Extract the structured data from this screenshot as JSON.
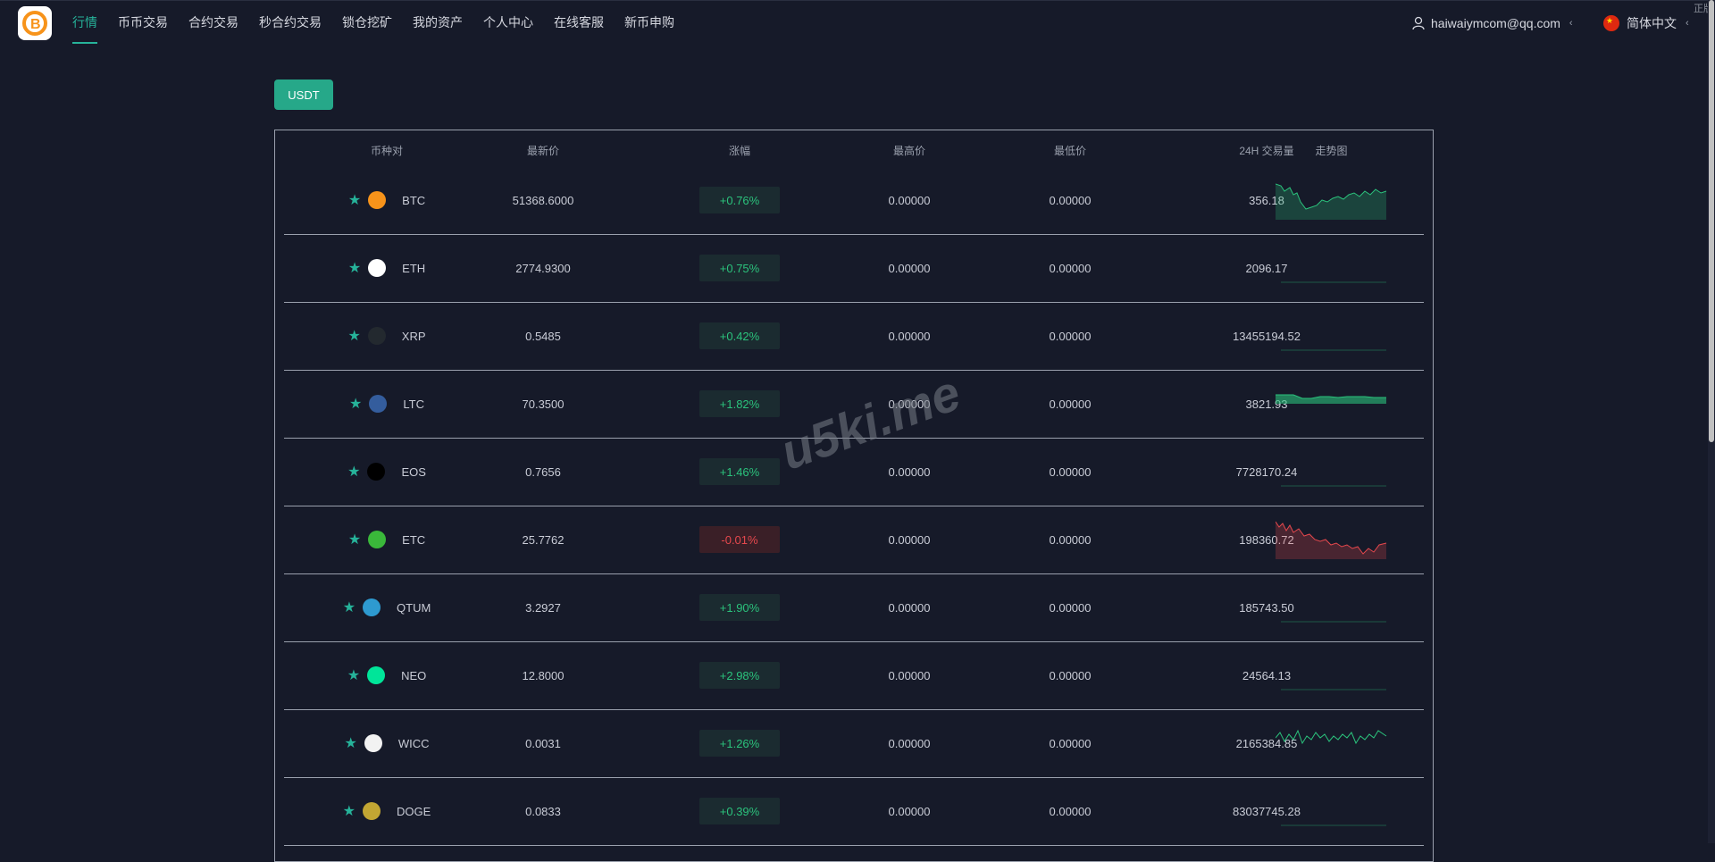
{
  "nav": {
    "items": [
      {
        "label": "行情",
        "active": true
      },
      {
        "label": "币币交易"
      },
      {
        "label": "合约交易"
      },
      {
        "label": "秒合约交易"
      },
      {
        "label": "锁仓挖矿"
      },
      {
        "label": "我的资产"
      },
      {
        "label": "个人中心"
      },
      {
        "label": "在线客服"
      },
      {
        "label": "新币申购"
      }
    ],
    "user_email": "haiwaiymcom@qq.com",
    "language": "简体中文",
    "corner_text": "正版"
  },
  "market_tab": "USDT",
  "table": {
    "headers": [
      "币种对",
      "最新价",
      "涨幅",
      "最高价",
      "最低价",
      "24H 交易量",
      "走势图"
    ],
    "rows": [
      {
        "symbol": "BTC",
        "price": "51368.6000",
        "change": "+0.76%",
        "high": "0.00000",
        "low": "0.00000",
        "volume": "356.18",
        "trend": "up",
        "coin_color": "#f7931a",
        "icon": "bitcoin-icon"
      },
      {
        "symbol": "ETH",
        "price": "2774.9300",
        "change": "+0.75%",
        "high": "0.00000",
        "low": "0.00000",
        "volume": "2096.17",
        "trend": "flat",
        "coin_color": "#ffffff",
        "icon": "ethereum-icon"
      },
      {
        "symbol": "XRP",
        "price": "0.5485",
        "change": "+0.42%",
        "high": "0.00000",
        "low": "0.00000",
        "volume": "13455194.52",
        "trend": "flat",
        "coin_color": "#23292f",
        "icon": "ripple-icon"
      },
      {
        "symbol": "LTC",
        "price": "70.3500",
        "change": "+1.82%",
        "high": "0.00000",
        "low": "0.00000",
        "volume": "3821.93",
        "trend": "band",
        "coin_color": "#345d9d",
        "icon": "litecoin-icon"
      },
      {
        "symbol": "EOS",
        "price": "0.7656",
        "change": "+1.46%",
        "high": "0.00000",
        "low": "0.00000",
        "volume": "7728170.24",
        "trend": "flat",
        "coin_color": "#000000",
        "icon": "eos-icon"
      },
      {
        "symbol": "ETC",
        "price": "25.7762",
        "change": "-0.01%",
        "high": "0.00000",
        "low": "0.00000",
        "volume": "198360.72",
        "trend": "down",
        "coin_color": "#3ab83a",
        "icon": "ethereum-classic-icon"
      },
      {
        "symbol": "QTUM",
        "price": "3.2927",
        "change": "+1.90%",
        "high": "0.00000",
        "low": "0.00000",
        "volume": "185743.50",
        "trend": "flat",
        "coin_color": "#2e9ad0",
        "icon": "qtum-icon"
      },
      {
        "symbol": "NEO",
        "price": "12.8000",
        "change": "+2.98%",
        "high": "0.00000",
        "low": "0.00000",
        "volume": "24564.13",
        "trend": "flat",
        "coin_color": "#00e599",
        "icon": "neo-icon"
      },
      {
        "symbol": "WICC",
        "price": "0.0031",
        "change": "+1.26%",
        "high": "0.00000",
        "low": "0.00000",
        "volume": "2165384.85",
        "trend": "wavy",
        "coin_color": "#f2f2f2",
        "icon": "wicc-icon"
      },
      {
        "symbol": "DOGE",
        "price": "0.0833",
        "change": "+0.39%",
        "high": "0.00000",
        "low": "0.00000",
        "volume": "83037745.28",
        "trend": "flat",
        "coin_color": "#c2a633",
        "icon": "dogecoin-icon"
      }
    ]
  },
  "watermark": "u5ki.me",
  "colors": {
    "accent": "#26b39a",
    "up": "#2bc27c",
    "down": "#e5484d",
    "background": "#161a29"
  }
}
